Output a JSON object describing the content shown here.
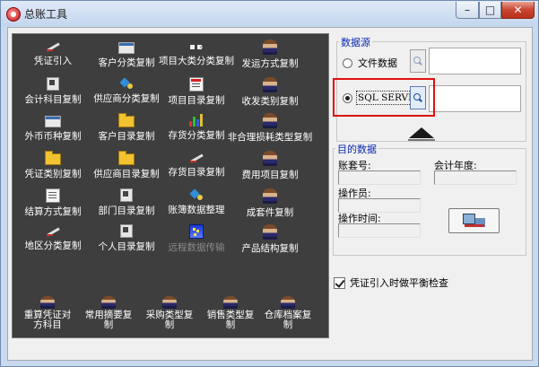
{
  "window": {
    "title": "总账工具",
    "min_glyph": "–",
    "max_glyph": "□",
    "close_glyph": "✕"
  },
  "tools": [
    {
      "key": "voucher-import",
      "label": "凭证引入",
      "icon": "voucher-import-icon"
    },
    {
      "key": "customer-class-copy",
      "label": "客户分类复制",
      "icon": "customer-class-icon"
    },
    {
      "key": "project-major-class-copy",
      "label": "项目大类分类复制",
      "icon": "project-class-icon"
    },
    {
      "key": "shipping-method-copy",
      "label": "发运方式复制",
      "icon": "person-icon"
    },
    {
      "key": "account-subject-copy",
      "label": "会计科目复制",
      "icon": "account-subject-icon"
    },
    {
      "key": "supplier-class-copy",
      "label": "供应商分类复制",
      "icon": "supplier-class-icon"
    },
    {
      "key": "project-catalog-copy",
      "label": "项目目录复制",
      "icon": "project-catalog-icon"
    },
    {
      "key": "receive-dispatch-class-copy",
      "label": "收发类别复制",
      "icon": "person-icon"
    },
    {
      "key": "foreign-currency-copy",
      "label": "外币币种复制",
      "icon": "currency-icon"
    },
    {
      "key": "customer-catalog-copy",
      "label": "客户目录复制",
      "icon": "customer-catalog-icon"
    },
    {
      "key": "inventory-class-copy",
      "label": "存货分类复制",
      "icon": "inventory-class-icon"
    },
    {
      "key": "abnormal-loss-type-copy",
      "label": "非合理损耗类型复制",
      "icon": "person-icon"
    },
    {
      "key": "voucher-type-copy",
      "label": "凭证类别复制",
      "icon": "voucher-type-icon"
    },
    {
      "key": "supplier-catalog-copy",
      "label": "供应商目录复制",
      "icon": "supplier-catalog-icon"
    },
    {
      "key": "inventory-catalog-copy",
      "label": "存货目录复制",
      "icon": "inventory-catalog-icon"
    },
    {
      "key": "expense-item-copy",
      "label": "费用项目复制",
      "icon": "person-icon"
    },
    {
      "key": "settlement-method-copy",
      "label": "结算方式复制",
      "icon": "settlement-icon"
    },
    {
      "key": "department-catalog-copy",
      "label": "部门目录复制",
      "icon": "department-icon"
    },
    {
      "key": "ledger-data-cleanup",
      "label": "账簿数据整理",
      "icon": "ledger-icon"
    },
    {
      "key": "assembly-copy",
      "label": "成套件复制",
      "icon": "person-icon"
    },
    {
      "key": "region-class-copy",
      "label": "地区分类复制",
      "icon": "region-icon"
    },
    {
      "key": "personal-catalog-copy",
      "label": "个人目录复制",
      "icon": "personal-icon"
    },
    {
      "key": "remote-data-transfer",
      "label": "远程数据传输",
      "icon": "remote-transfer-icon",
      "disabled": true
    },
    {
      "key": "product-structure-copy",
      "label": "产品结构复制",
      "icon": "person-icon"
    },
    {
      "key": "recalc-voucher-counter-subject",
      "label": "重算凭证对方科目",
      "icon": "person-icon",
      "multi": true
    },
    {
      "key": "common-summary-copy",
      "label": "常用摘要复制",
      "icon": "person-icon",
      "multi": true
    },
    {
      "key": "purchase-type-copy",
      "label": "采购类型复制",
      "icon": "person-icon",
      "multi": true
    },
    {
      "key": "sales-type-copy",
      "label": "销售类型复制",
      "icon": "person-icon",
      "multi": true
    },
    {
      "key": "warehouse-archive-copy",
      "label": "仓库档案复制",
      "icon": "person-icon",
      "multi": true
    }
  ],
  "source": {
    "group_label": "数据源",
    "file_option": "文件数据",
    "sql_option": "SQL SERVER",
    "selected": "sql",
    "file_path_value": "",
    "sql_server_value": ""
  },
  "target": {
    "group_label": "目的数据",
    "account_no_label": "账套号:",
    "account_no_value": "",
    "fiscal_year_label": "会计年度:",
    "fiscal_year_value": "",
    "operator_label": "操作员:",
    "operator_value": "",
    "operate_time_label": "操作时间:",
    "operate_time_value": ""
  },
  "balance_check": {
    "label": "凭证引入时做平衡检查",
    "checked": true
  },
  "colors": {
    "panel_bg": "#3e3e3e",
    "group_label": "#0a2ab0",
    "highlight": "#e01010"
  }
}
